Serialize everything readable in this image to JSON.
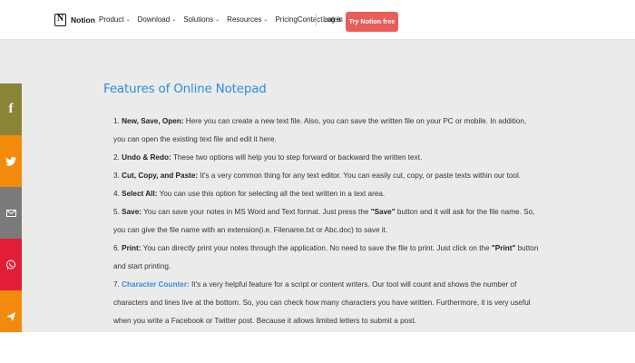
{
  "nav": {
    "brand": "Notion",
    "links": [
      {
        "label": "Product",
        "has_dropdown": true
      },
      {
        "label": "Download",
        "has_dropdown": true
      },
      {
        "label": "Solutions",
        "has_dropdown": true
      },
      {
        "label": "Resources",
        "has_dropdown": true
      },
      {
        "label": "Pricing",
        "has_dropdown": false
      },
      {
        "label": "Contact sales",
        "has_dropdown": false
      }
    ],
    "login": "Log in",
    "cta": "Try Notion free",
    "cta_color": "#e95e5a"
  },
  "social": [
    {
      "name": "facebook",
      "icon": "f",
      "color": "#8a8437"
    },
    {
      "name": "twitter",
      "icon": "twitter-bird",
      "color": "#f28a0c"
    },
    {
      "name": "email",
      "icon": "envelope",
      "color": "#7a7a7a"
    },
    {
      "name": "whatsapp",
      "icon": "whatsapp",
      "color": "#e21d37"
    },
    {
      "name": "share",
      "icon": "share",
      "color": "#f28a0c"
    }
  ],
  "main": {
    "heading": "Features of Online Notepad",
    "features": [
      {
        "n": "1.",
        "term": "New, Save, Open:",
        "text": " Here you can create a new text file. Also, you can save the written file on your PC or mobile. In addition, you can open the existing text file and edit it here."
      },
      {
        "n": "2.",
        "term": "Undo & Redo:",
        "text": " These two options will help you to step forward or backward the written text."
      },
      {
        "n": "3.",
        "term": "Cut, Copy, and Paste:",
        "text": " It's a very common thing for any text editor. You can easily cut, copy, or paste texts within our tool."
      },
      {
        "n": "4.",
        "term": "Select All:",
        "text": " You can use this option for selecting all the text written in a text area."
      },
      {
        "n": "5.",
        "term": "Save:",
        "text_a": " You can save your notes in MS Word and Text format. Just press the ",
        "strong": "\"Save\"",
        "text_b": " button and it will ask for the file name. So, you can give the file name with an extension(i.e. Filename.txt or Abc.doc) to save it."
      },
      {
        "n": "6.",
        "term": "Print:",
        "text_a": " You can directly print your notes through the application. No need to save the file to print. Just click on the ",
        "strong": "\"Print\"",
        "text_b": " button and start printing."
      },
      {
        "n": "7.",
        "term": "Character Counter:",
        "text": " It's a very helpful feature for a script or content writers. Our tool will count and shows the number of characters and lines live at the bottom. So, you can check how many characters you have written. Furthermore, it is very useful when you write a Facebook or Twitter post. Because it allows limited letters to submit a post."
      }
    ]
  },
  "colors": {
    "heading": "#2d8de0",
    "background": "#ebebe9"
  }
}
